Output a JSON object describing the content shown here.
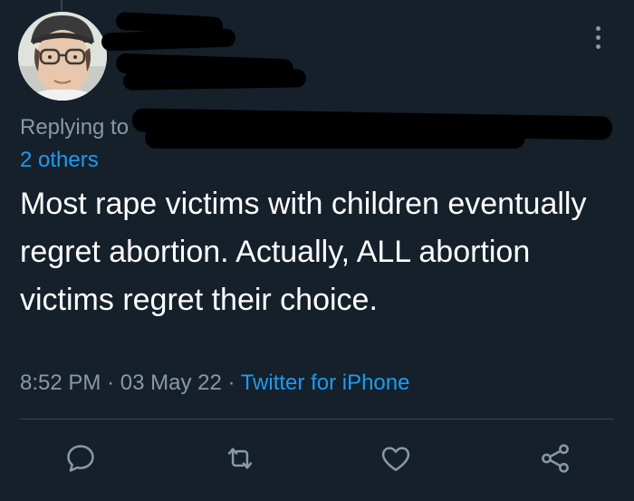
{
  "tweet": {
    "replying_prefix": "Replying to",
    "replying_others": "2 others",
    "text": "Most rape victims with children eventually regret abortion. Actually, ALL abortion victims regret their choice.",
    "time": "8:52 PM",
    "date": "03 May 22",
    "separator": "·",
    "source": "Twitter for iPhone"
  },
  "icons": {
    "reply": "reply-icon",
    "retweet": "retweet-icon",
    "like": "heart-icon",
    "share": "share-icon",
    "more": "more-vertical-icon"
  },
  "colors": {
    "background": "#15202b",
    "text": "#ffffff",
    "muted": "#8899a6",
    "link": "#1d9bf0",
    "divider": "#38444d"
  }
}
